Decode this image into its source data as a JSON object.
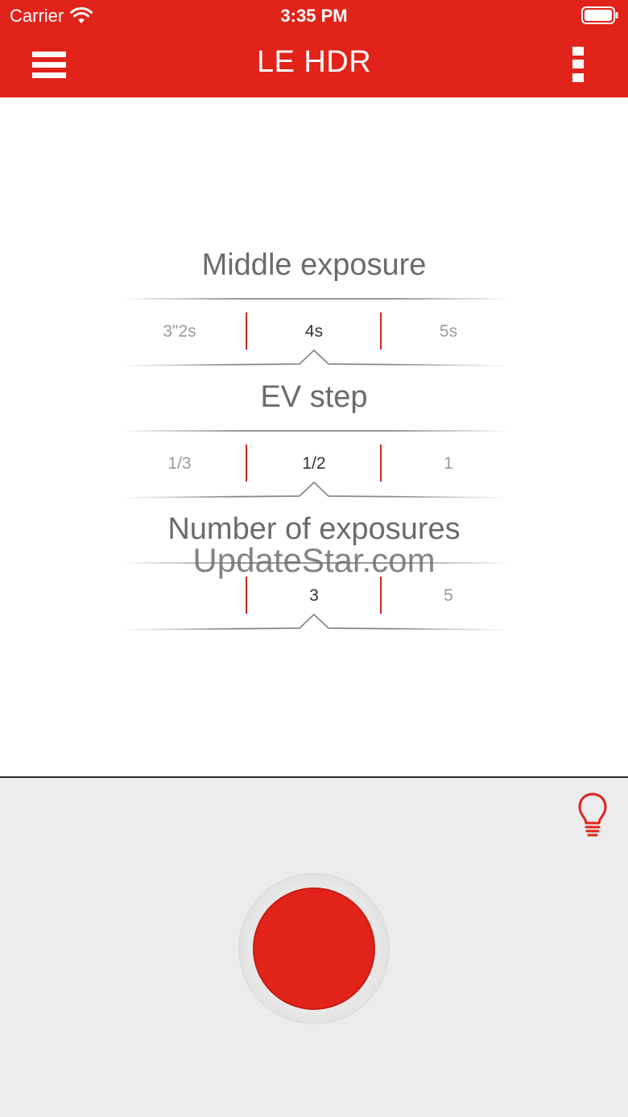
{
  "status_bar": {
    "carrier": "Carrier",
    "time": "3:35 PM"
  },
  "nav": {
    "title": "LE HDR",
    "menu_icon": "hamburger-menu-icon",
    "more_icon": "vertical-more-icon"
  },
  "pickers": [
    {
      "title": "Middle exposure",
      "values": [
        "3\"2s",
        "4s",
        "5s"
      ],
      "selected_index": 1
    },
    {
      "title": "EV step",
      "values": [
        "1/3",
        "1/2",
        "1"
      ],
      "selected_index": 1
    },
    {
      "title": "Number of exposures",
      "values": [
        "",
        "3",
        "5"
      ],
      "selected_index": 1
    }
  ],
  "watermark": "UpdateStar.com",
  "bottom": {
    "tip_icon": "lightbulb-icon",
    "shutter_icon": "record-button"
  },
  "colors": {
    "accent": "#e2231a",
    "panel": "#ececec"
  }
}
